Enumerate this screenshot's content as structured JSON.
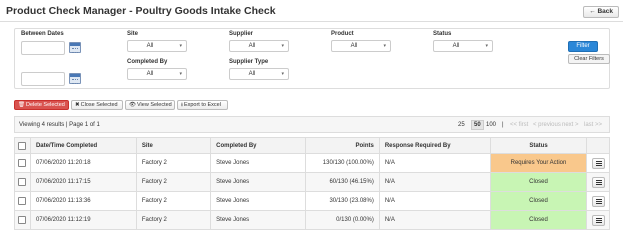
{
  "header": {
    "title": "Product Check Manager - Poultry Goods Intake Check",
    "back_label": "← Back"
  },
  "filters": {
    "between_dates_label": "Between Dates",
    "date_from": "",
    "date_to": "",
    "site_label": "Site",
    "site_value": "All",
    "supplier_label": "Supplier",
    "supplier_value": "All",
    "product_label": "Product",
    "product_value": "All",
    "status_label": "Status",
    "status_value": "All",
    "completed_by_label": "Completed By",
    "completed_by_value": "All",
    "supplier_type_label": "Supplier Type",
    "supplier_type_value": "All",
    "filter_button": "Filter",
    "clear_button": "Clear Filters"
  },
  "actions": {
    "delete": "Delete Selected",
    "close": "Close Selected",
    "view": "View Selected",
    "export": "Export to Excel"
  },
  "results": {
    "info": "Viewing 4 results | Page 1 of 1",
    "page_sizes": [
      "25",
      "50",
      "100"
    ],
    "active_page_size": "50",
    "separator": "|",
    "first": "<< first",
    "previous": "< previous",
    "next": "next >",
    "last": "last >>"
  },
  "table": {
    "columns": [
      "Date/Time Completed",
      "Site",
      "Completed By",
      "Points",
      "Response Required By",
      "Status"
    ],
    "rows": [
      {
        "date": "07/06/2020 11:20:18",
        "site": "Factory 2",
        "completed_by": "Steve Jones",
        "points": "130/130 (100.00%)",
        "response": "N/A",
        "status": "Requires Your Action",
        "status_color": "#f9c88c"
      },
      {
        "date": "07/06/2020 11:17:15",
        "site": "Factory 2",
        "completed_by": "Steve Jones",
        "points": "60/130 (46.15%)",
        "response": "N/A",
        "status": "Closed",
        "status_color": "#c8f5b4"
      },
      {
        "date": "07/06/2020 11:13:36",
        "site": "Factory 2",
        "completed_by": "Steve Jones",
        "points": "30/130 (23.08%)",
        "response": "N/A",
        "status": "Closed",
        "status_color": "#c8f5b4"
      },
      {
        "date": "07/06/2020 11:12:19",
        "site": "Factory 2",
        "completed_by": "Steve Jones",
        "points": "0/130 (0.00%)",
        "response": "N/A",
        "status": "Closed",
        "status_color": "#c8f5b4"
      }
    ]
  },
  "colors": {
    "primary": "#2a87d8",
    "danger": "#d9534f",
    "action_required": "#f9c88c",
    "closed": "#c8f5b4"
  },
  "icons": {
    "back": "arrow-left-icon",
    "calendar": "calendar-icon",
    "delete": "trash-icon",
    "close": "x-icon",
    "view": "eye-icon",
    "export": "download-icon",
    "row_menu": "hamburger-menu-icon"
  }
}
